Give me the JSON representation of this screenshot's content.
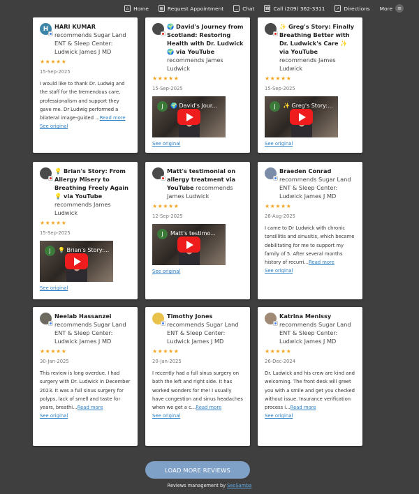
{
  "nav": {
    "home": "Home",
    "request": "Request Appointment",
    "chat": "Chat",
    "call": "Call (209) 362-3311",
    "directions": "Directions",
    "more": "More"
  },
  "see_original": "See original",
  "read_more": "Read more",
  "load_more": "LOAD MORE REVIEWS",
  "footer": {
    "prefix": "Reviews management by ",
    "brand": "SeoSamba"
  },
  "reviews": [
    {
      "name": "HARI KUMAR",
      "action": " recommends Sugar Land ENT & Sleep Center: Ludwick James J MD",
      "stars": "★★★★★",
      "date": "15-Sep-2025",
      "text": "I would like to thank Dr. Ludwig and the staff for the tremendous care, professionalism and support they gave me. Dr Ludwig performed a bilateral image-guided ...",
      "avatar_letter": "H",
      "avatar_color": "#3d86a8"
    },
    {
      "name": "🌍 David's Journey from Scotland: Restoring Health with Dr. Ludwick 🌍 via YouTube",
      "action": " recommends James Ludwick",
      "stars": "★★★★★",
      "date": "15-Sep-2025",
      "video_channel": "J",
      "video_title": "🌍 David's Jour..."
    },
    {
      "name": "✨ Greg's Story: Finally Breathing Better with Dr. Ludwick's Care ✨ via YouTube",
      "action": " recommends James Ludwick",
      "stars": "★★★★★",
      "date": "15-Sep-2025",
      "video_channel": "J",
      "video_title": "✨ Greg's Story:..."
    },
    {
      "name": "💡 Brian's Story: From Allergy Misery to Breathing Freely Again 💡 via YouTube",
      "action": " recommends James Ludwick",
      "stars": "★★★★★",
      "date": "15-Sep-2025",
      "video_channel": "J",
      "video_title": "💡 Brian's Story:..."
    },
    {
      "name": "Matt's testimonial on allergy treatment via YouTube",
      "action": " recommends James Ludwick",
      "stars": "★★★★★",
      "date": "12-Sep-2025",
      "video_channel": "J",
      "video_title": "Matt's testimo..."
    },
    {
      "name": "Braeden Conrad",
      "action": " recommends Sugar Land ENT & Sleep Center: Ludwick James J MD",
      "stars": "★★★★★",
      "date": "28-Aug-2025",
      "text": "I came to Dr Ludwick with chronic tonsillitis and sinusitis, which became debilitating for me to support my family of 5. After several months history of recurri...",
      "avatar_color": "#7a8ca8"
    },
    {
      "name": "Neelab Hassanzei",
      "action": " recommends Sugar Land ENT & Sleep Center: Ludwick James J MD",
      "stars": "★★★★★",
      "date": "30-Jan-2025",
      "text": "This review is long overdue. I had surgery with Dr. Ludwick in December 2023. It was a full sinus surgery for polyps, lack of smell and taste for years, breathi...",
      "avatar_color": "#6d6a60"
    },
    {
      "name": "Timothy Jones",
      "action": " recommends Sugar Land ENT & Sleep Center: Ludwick James J MD",
      "stars": "★★★★★",
      "date": "20-Jan-2025",
      "text": "I recently had a full sinus surgery on both the left and right side. It has worked wonders for me! I usually have congestion and sinus headaches when we get a c...",
      "avatar_color": "#e8c24a"
    },
    {
      "name": "Katrina Menissy",
      "action": " recommends Sugar Land ENT & Sleep Center: Ludwick James J MD",
      "stars": "★★★★★",
      "date": "26-Dec-2024",
      "text": "Dr. Ludwick and his crew are kind and welcoming. The front desk will greet you with a smile and get you checked without issue. Insurance verification process i...",
      "avatar_color": "#a08a76"
    }
  ]
}
